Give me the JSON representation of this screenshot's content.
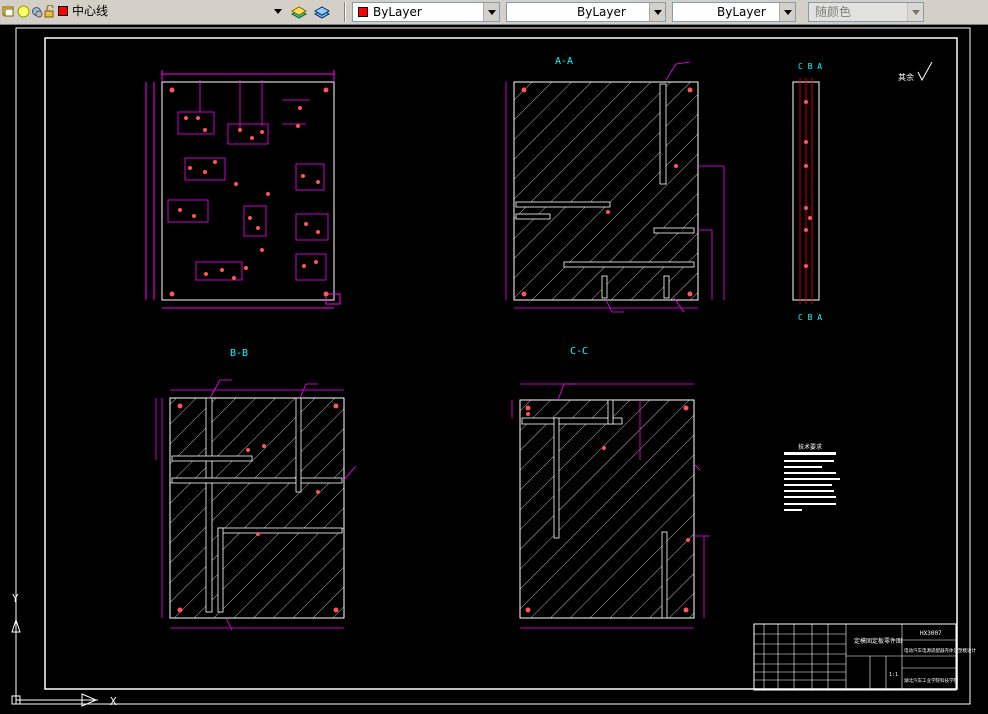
{
  "layer_toolbar": {
    "layer_name": "中心线",
    "icons": [
      "layer-manager-icon",
      "lightbulb-icon",
      "sun-icon",
      "lock-icon",
      "color-swatch-icon"
    ]
  },
  "properties_toolbar": {
    "color_value": "ByLayer",
    "linetype_value": "ByLayer",
    "lineweight_value": "ByLayer",
    "plotstyle_value": "随颜色"
  },
  "colors": {
    "background": "#000000",
    "frame": "#ffffff",
    "dimension": "#ff00ff",
    "hatch": "#ffffff",
    "holes": "#ff5555",
    "section_label": "#00ffff"
  },
  "drawing": {
    "section_labels": [
      "A-A",
      "B-B",
      "C-C"
    ],
    "side_view_top_label": "C B A",
    "side_view_bottom_label": "C B A",
    "roughness_label": "其余",
    "notes_title": "技术要求",
    "title_block": {
      "drawing_name": "定模固定板零件图",
      "part_no": "HX3007",
      "project": "电动汽车电源适配器壳体注塑模设计",
      "school": "湖北汽车工业学院科技学院",
      "scale": "1:1"
    }
  },
  "ucs": {
    "x_label": "X",
    "y_label": "Y"
  }
}
